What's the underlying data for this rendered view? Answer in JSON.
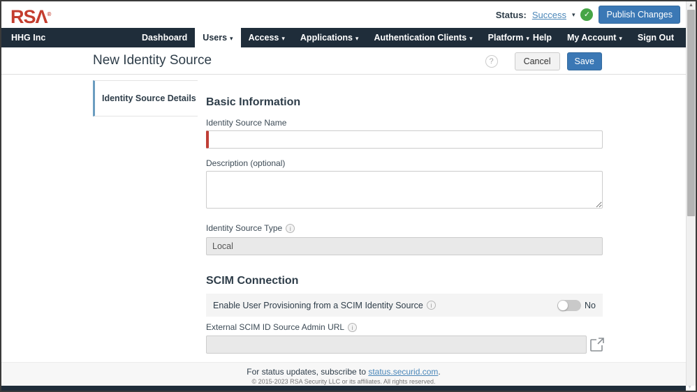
{
  "topbar": {
    "logo": "RSΛ",
    "logo_reg": "®",
    "status_label": "Status:",
    "status_value": "Success",
    "publish_button": "Publish Changes"
  },
  "navbar": {
    "org": "HHG Inc",
    "items": [
      {
        "label": "Dashboard",
        "caret": false,
        "active": false
      },
      {
        "label": "Users",
        "caret": true,
        "active": true
      },
      {
        "label": "Access",
        "caret": true,
        "active": false
      },
      {
        "label": "Applications",
        "caret": true,
        "active": false
      },
      {
        "label": "Authentication Clients",
        "caret": true,
        "active": false
      },
      {
        "label": "Platform",
        "caret": true,
        "active": false
      }
    ],
    "right_items": [
      {
        "label": "Help",
        "caret": false
      },
      {
        "label": "My Account",
        "caret": true
      },
      {
        "label": "Sign Out",
        "caret": false
      }
    ]
  },
  "page_header": {
    "title": "New Identity Source",
    "cancel_button": "Cancel",
    "save_button": "Save"
  },
  "sidebar": {
    "items": [
      {
        "label": "Identity Source Details",
        "active": true
      }
    ]
  },
  "form": {
    "basic_section_title": "Basic Information",
    "name_label": "Identity Source Name",
    "name_value": "",
    "description_label": "Description (optional)",
    "description_value": "",
    "type_label": "Identity Source Type",
    "type_value": "Local",
    "scim_section_title": "SCIM Connection",
    "scim_toggle_label": "Enable User Provisioning from a SCIM Identity Source",
    "scim_toggle_state": "No",
    "scim_url_label": "External SCIM ID Source Admin URL",
    "scim_url_value": ""
  },
  "footer": {
    "status_prefix": "For status updates, subscribe to ",
    "status_link": "status.securid.com",
    "status_suffix": ".",
    "copyright": "© 2015-2023 RSA Security LLC or its affiliates. All rights reserved."
  },
  "colors": {
    "navbar_dark": "#1f2d3a",
    "rsa_red": "#c43d2e",
    "accent_blue": "#3b78b5",
    "link_blue": "#4a86b8",
    "success_green": "#46a546",
    "required_red": "#bf3e36",
    "sidebar_accent": "#6b9dc0"
  }
}
